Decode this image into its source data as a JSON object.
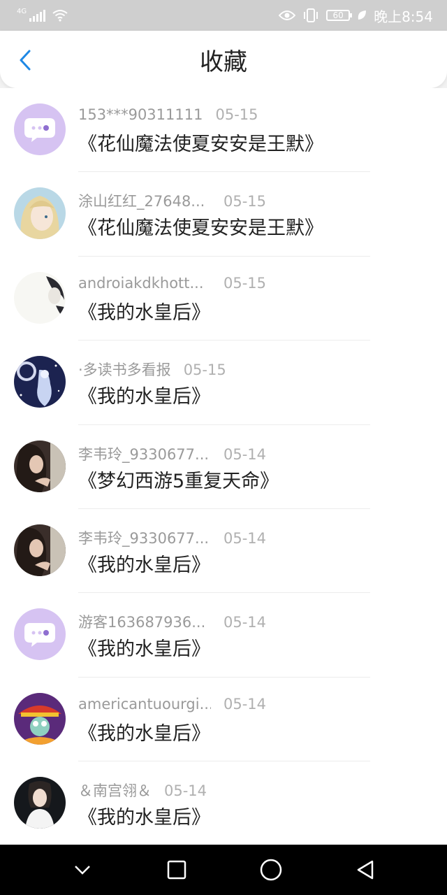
{
  "status_bar": {
    "network": "4G",
    "battery": "60",
    "time": "晚上8:54"
  },
  "header": {
    "title": "收藏",
    "back_icon": "chevron-left-icon"
  },
  "favorites": [
    {
      "nickname": "153***90311111",
      "date": "05-15",
      "book": "《花仙魔法使夏安安是王默》",
      "avatar": "default-chat-icon"
    },
    {
      "nickname": "涂山红红_27648...",
      "date": "05-15",
      "book": "《花仙魔法使夏安安是王默》",
      "avatar": "anime-girl"
    },
    {
      "nickname": "androiakdkhott...",
      "date": "05-15",
      "book": "《我的水皇后》",
      "avatar": "sketch-portrait"
    },
    {
      "nickname": "·多读书多看报",
      "date": "05-15",
      "book": "《我的水皇后》",
      "avatar": "night-fairy"
    },
    {
      "nickname": "李韦玲_9330677...",
      "date": "05-14",
      "book": "《梦幻西游5重复天命》",
      "avatar": "photo-portrait"
    },
    {
      "nickname": "李韦玲_9330677...",
      "date": "05-14",
      "book": "《我的水皇后》",
      "avatar": "photo-portrait"
    },
    {
      "nickname": "游客163687936...",
      "date": "05-14",
      "book": "《我的水皇后》",
      "avatar": "default-chat-icon"
    },
    {
      "nickname": "americantuourgi...",
      "date": "05-14",
      "book": "《我的水皇后》",
      "avatar": "cartoon-squid"
    },
    {
      "nickname": "＆南宫翎＆",
      "date": "05-14",
      "book": "《我的水皇后》",
      "avatar": "dark-portrait"
    }
  ],
  "colors": {
    "accent": "#1e88e5",
    "default_avatar": "#d6c3f2",
    "status_bar": "#cfcfcf"
  }
}
